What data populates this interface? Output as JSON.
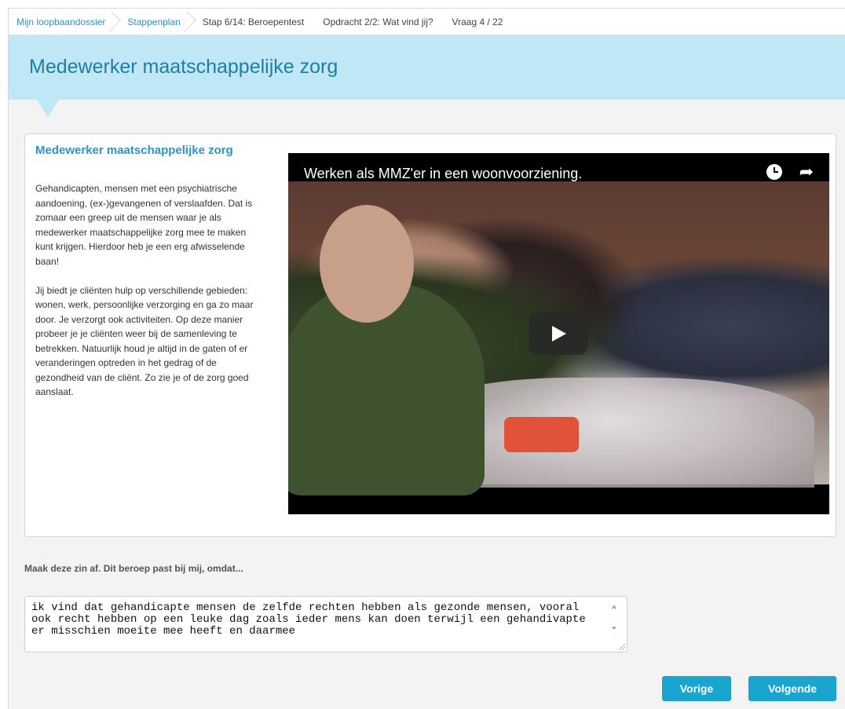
{
  "breadcrumb": {
    "items": [
      {
        "label": "Mijn loopbaandossier"
      },
      {
        "label": "Stappenplan"
      },
      {
        "label": "Stap 6/14: Beroepentest"
      },
      {
        "label": "Opdracht 2/2: Wat vind jij?"
      },
      {
        "label": "Vraag 4 / 22"
      }
    ]
  },
  "header": {
    "title": "Medewerker maatschappelijke zorg"
  },
  "panel": {
    "title": "Medewerker maatschappelijke zorg",
    "paragraphs": [
      "Gehandicapten, mensen met een psychiatrische aandoening, (ex-)gevangenen of verslaafden. Dat is zomaar een greep uit de mensen waar je als medewerker maatschappelijke zorg mee te maken kunt krijgen. Hierdoor heb je een erg afwisselende baan!",
      "Jij biedt je cliënten hulp op verschillende gebieden: wonen, werk, persoonlijke verzorging en ga zo maar door. Je verzorgt ook activiteiten. Op deze manier probeer je je cliënten weer bij de samenleving te betrekken. Natuurlijk houd je altijd in de gaten of er veranderingen optreden in het gedrag of de gezondheid van de cliënt. Zo zie je of de zorg goed aanslaat."
    ],
    "video": {
      "title": "Werken als MMZ'er in een woonvoorziening.",
      "icons": [
        "clock-icon",
        "share-icon",
        "play-icon"
      ]
    }
  },
  "question": {
    "label": "Maak deze zin af. Dit beroep past bij mij, omdat...",
    "answer": "ik vind dat gehandicapte mensen de zelfde rechten hebben als gezonde mensen, vooral ook recht hebben op een leuke dag zoals ieder mens kan doen terwijl een gehandivapte er misschien moeite mee heeft en daarmee"
  },
  "buttons": {
    "prev": "Vorige",
    "next": "Volgende"
  },
  "colors": {
    "accent": "#2b95c8",
    "header_band": "#bfe7f5",
    "title": "#1d7ea8",
    "button": "#1aa5d0"
  }
}
